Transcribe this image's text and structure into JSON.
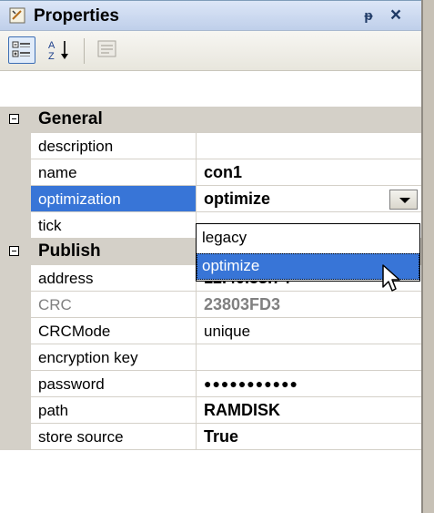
{
  "window": {
    "title": "Properties",
    "title_icon": "properties-icon",
    "pin_glyph": "ᵽ",
    "close_glyph": "×"
  },
  "toolbar": {
    "categorized": "categorized-icon",
    "alphabetical": "alphabetical-icon",
    "property_pages": "property-pages-icon"
  },
  "grid": {
    "categories": [
      {
        "label": "General",
        "properties": [
          {
            "name": "description",
            "value": ""
          },
          {
            "name": "name",
            "value": "con1"
          },
          {
            "name": "optimization",
            "value": "optimize",
            "selected": true,
            "dropdown": true
          },
          {
            "name": "tick",
            "value": ""
          }
        ]
      },
      {
        "label": "Publish",
        "properties": [
          {
            "name": "address",
            "value": "12.40.53.74"
          },
          {
            "name": "CRC",
            "value": "23803FD3",
            "disabled": true
          },
          {
            "name": "CRCMode",
            "value": "unique",
            "bold": false
          },
          {
            "name": "encryption key",
            "value": ""
          },
          {
            "name": "password",
            "value": "●●●●●●●●●●●"
          },
          {
            "name": "path",
            "value": "RAMDISK"
          },
          {
            "name": "store source",
            "value": "True"
          }
        ]
      }
    ]
  },
  "dropdown": {
    "options": [
      "legacy",
      "optimize"
    ],
    "highlighted": "optimize"
  },
  "colors": {
    "selection": "#3875d7",
    "margin": "#d4d0c8",
    "title_gradient_top": "#dce6f7"
  }
}
